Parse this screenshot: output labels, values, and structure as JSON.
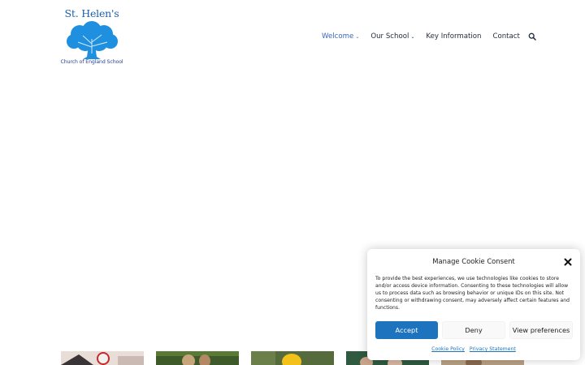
{
  "logo": {
    "title": "St. Helen's",
    "subtitle": "Church of England School"
  },
  "nav": {
    "items": [
      {
        "label": "Welcome",
        "has_dropdown": true,
        "active": true
      },
      {
        "label": "Our School",
        "has_dropdown": true,
        "active": false
      },
      {
        "label": "Key Information",
        "has_dropdown": false,
        "active": false
      },
      {
        "label": "Contact",
        "has_dropdown": false,
        "active": false
      }
    ],
    "search_icon": "search-icon"
  },
  "colors": {
    "brand_blue": "#1c5fae",
    "tree_blue": "#1f8fe0",
    "nav_active": "#3867bf",
    "accept_blue": "#1e73be"
  },
  "cookie": {
    "title": "Manage Cookie Consent",
    "text": "To provide the best experiences, we use technologies like cookies to store and/or access device information. Consenting to these technologies will allow us to process data such as browsing behavior or unique IDs on this site. Not consenting or withdrawing consent, may adversely affect certain features and functions.",
    "accept_label": "Accept",
    "deny_label": "Deny",
    "preferences_label": "View preferences",
    "cookie_policy_label": "Cookie Policy",
    "privacy_statement_label": "Privacy Statement"
  }
}
